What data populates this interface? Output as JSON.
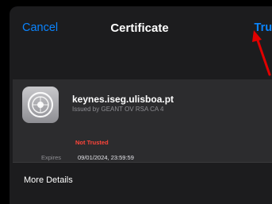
{
  "navbar": {
    "cancel_label": "Cancel",
    "title": "Certificate",
    "trust_label": "Trust"
  },
  "certificate": {
    "domain": "keynes.iseg.ulisboa.pt",
    "issuer": "Issued by GEANT OV RSA CA 4",
    "status": "Not Trusted",
    "expires_label": "Expires",
    "expires_value": "09/01/2024, 23:59:59"
  },
  "more_details": {
    "label": "More Details",
    "chevron": "›"
  },
  "colors": {
    "accent": "#0a84ff",
    "warning": "#ff453a",
    "annotation_arrow": "#e00000"
  },
  "icons": {
    "certificate": "certificate-seal-icon",
    "arrow": "red-annotation-arrow",
    "chevron": "chevron-right-icon"
  }
}
